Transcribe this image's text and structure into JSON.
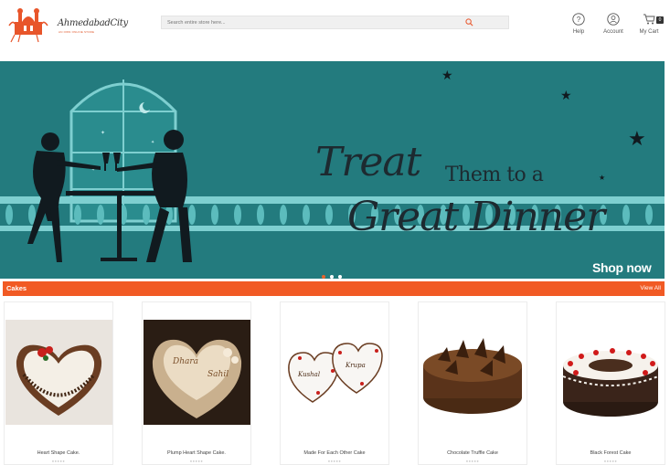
{
  "header": {
    "logo_text": "AhmedabadCity",
    "logo_tagline": "AN OWN ONLINE STORE",
    "search_placeholder": "Search entire store here...",
    "links": [
      {
        "label": "Help",
        "icon": "help-icon"
      },
      {
        "label": "Account",
        "icon": "account-icon"
      },
      {
        "label": "My Cart",
        "icon": "cart-icon",
        "count": "0"
      }
    ]
  },
  "banner": {
    "line1": "Treat",
    "line2": "Them to a",
    "line3": "Great Dinner",
    "cta": "Shop now",
    "slides": 3,
    "active_slide": 1
  },
  "section": {
    "title": "Cakes",
    "view_all": "View All"
  },
  "products": [
    {
      "name": "Heart Shape Cake."
    },
    {
      "name": "Plump Heart Shape Cake."
    },
    {
      "name": "Made For Each Other Cake"
    },
    {
      "name": "Chocolate Truffle Cake"
    },
    {
      "name": "Black Forest Cake"
    }
  ],
  "colors": {
    "accent": "#f15a24",
    "banner_bg": "#237b7e",
    "search_bg": "#f0f0f0"
  }
}
